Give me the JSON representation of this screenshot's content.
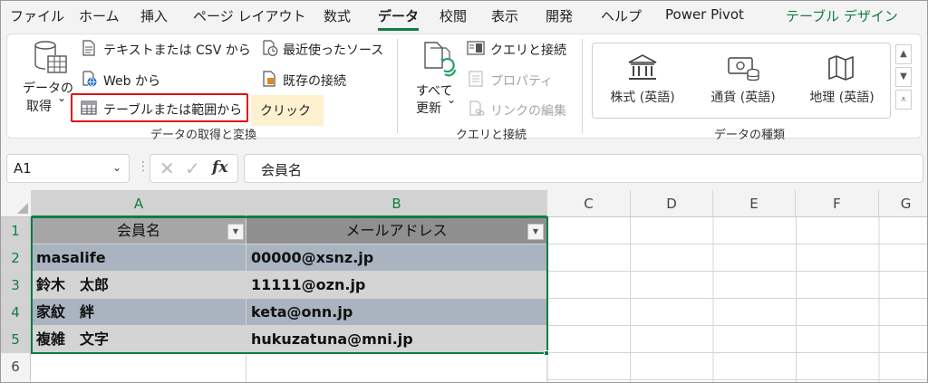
{
  "menu": {
    "tabs": [
      "ファイル",
      "ホーム",
      "挿入",
      "ページ レイアウト",
      "数式",
      "データ",
      "校閲",
      "表示",
      "開発",
      "ヘルプ",
      "Power Pivot",
      "テーブル デザイン"
    ]
  },
  "ribbon": {
    "get_data": {
      "line1": "データの",
      "line2": "取得",
      "dropdown": "⌄"
    },
    "text_csv": "テキストまたは CSV から",
    "web": "Web から",
    "table_range": "テーブルまたは範囲から",
    "recent_sources": "最近使ったソース",
    "existing_connections": "既存の接続",
    "tooltip": "クリック",
    "group_get_transform": "データの取得と変換",
    "refresh": {
      "line1": "すべて",
      "line2": "更新",
      "dropdown": "⌄"
    },
    "queries_connections": "クエリと接続",
    "properties": "プロパティ",
    "edit_links": "リンクの編集",
    "group_queries": "クエリと接続",
    "data_types": [
      "株式 (英語)",
      "通貨 (英語)",
      "地理 (英語)"
    ],
    "group_data_types": "データの種類"
  },
  "formula_bar": {
    "name_box": "A1",
    "name_box_arrow": "⌄",
    "content": "会員名"
  },
  "sheet": {
    "columns": [
      "A",
      "B",
      "C",
      "D",
      "E",
      "F",
      "G"
    ],
    "rows": [
      "1",
      "2",
      "3",
      "4",
      "5",
      "6"
    ],
    "headers": [
      "会員名",
      "メールアドレス"
    ],
    "records": [
      [
        "masalife",
        "00000@xsnz.jp"
      ],
      [
        "鈴木　太郎",
        "11111@ozn.jp"
      ],
      [
        "家紋　絆",
        "keta@onn.jp"
      ],
      [
        "複雑　文字",
        "hukuzatuna@mni.jp"
      ]
    ]
  },
  "colors": {
    "accent_green": "#107c41",
    "highlight_red": "#e01010",
    "tooltip_bg": "#fdf1cf",
    "table_header_a": "#a6a6a6",
    "table_header_b": "#8f8f8f",
    "table_band_dark": "#a9b4c0",
    "table_band_light": "#d4d4d4"
  }
}
